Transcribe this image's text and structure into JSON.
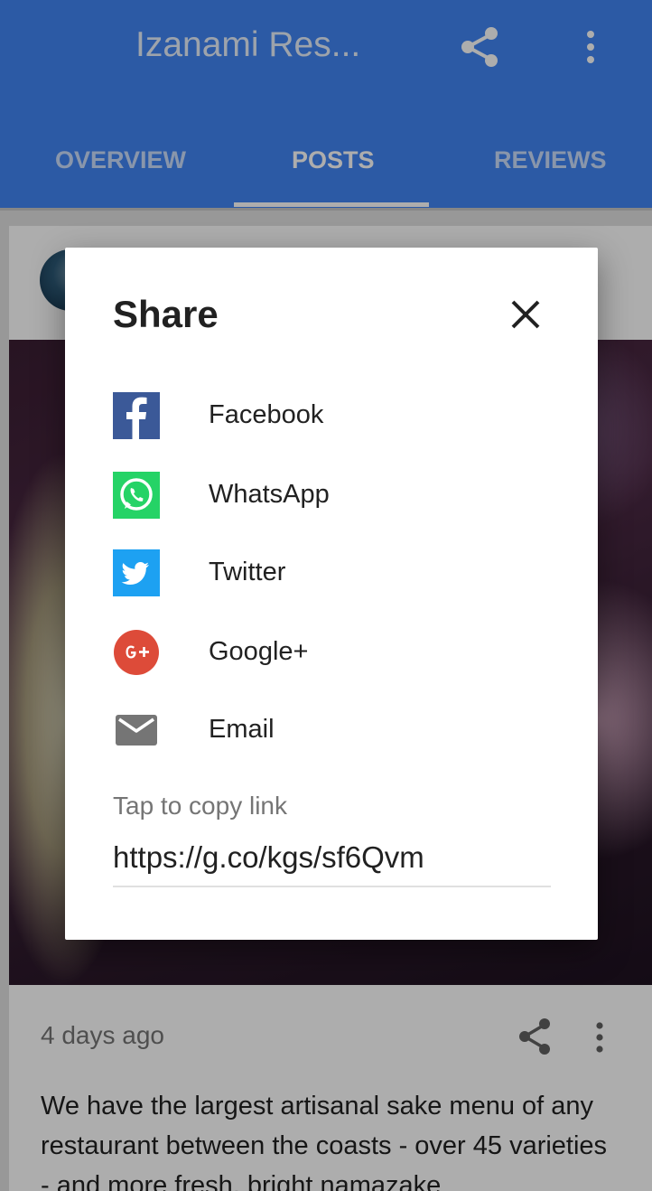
{
  "appbar": {
    "title": "Izanami Res...",
    "share_icon": "share-icon",
    "more_icon": "more-vert-icon"
  },
  "tabs": [
    {
      "label": "OVERVIEW",
      "active": false
    },
    {
      "label": "POSTS",
      "active": true
    },
    {
      "label": "REVIEWS",
      "active": false
    }
  ],
  "post": {
    "time": "4 days ago",
    "body": "We have the largest artisanal sake menu of any restaurant between the coasts - over 45 varieties - and more fresh, bright namazake"
  },
  "share_dialog": {
    "title": "Share",
    "close_icon": "close-icon",
    "items": [
      {
        "label": "Facebook",
        "icon": "facebook-icon",
        "color": "#3b5998"
      },
      {
        "label": "WhatsApp",
        "icon": "whatsapp-icon",
        "color": "#25d366"
      },
      {
        "label": "Twitter",
        "icon": "twitter-icon",
        "color": "#1da1f2"
      },
      {
        "label": "Google+",
        "icon": "google-plus-icon",
        "color": "#dd4b39"
      },
      {
        "label": "Email",
        "icon": "email-icon",
        "color": "#757575"
      }
    ],
    "copy_label": "Tap to copy link",
    "link": "https://g.co/kgs/sf6Qvm"
  },
  "colors": {
    "primary": "#4285f4",
    "scrim": "rgba(0,0,0,0.32)"
  }
}
